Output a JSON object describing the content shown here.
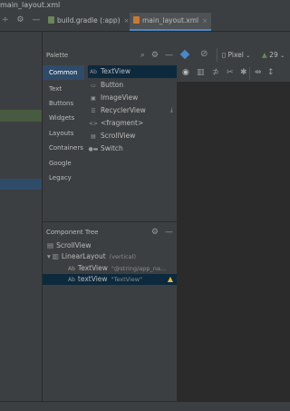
{
  "title": "main_layout.xml",
  "tabs": [
    {
      "label": "build.gradle (:app)",
      "close": "×"
    },
    {
      "label": "main_layout.xml",
      "close": "×"
    }
  ],
  "toolbar_icons": [
    "gear-icon",
    "minus-icon"
  ],
  "palette": {
    "title": "Palette",
    "categories": [
      "Common",
      "Text",
      "Buttons",
      "Widgets",
      "Layouts",
      "Containers",
      "Google",
      "Legacy"
    ],
    "widgets": [
      {
        "icon": "Ab",
        "label": "TextView"
      },
      {
        "icon": "▭",
        "label": "Button"
      },
      {
        "icon": "▣",
        "label": "ImageView"
      },
      {
        "icon": "☰",
        "label": "RecyclerView"
      },
      {
        "icon": "<>",
        "label": "<fragment>"
      },
      {
        "icon": "▤",
        "label": "ScrollView"
      },
      {
        "icon": "●▬",
        "label": "Switch"
      }
    ]
  },
  "design": {
    "device": "Pixel",
    "api": "29"
  },
  "component_tree": {
    "title": "Component Tree",
    "rows": [
      {
        "icon": "▤",
        "label": "ScrollView",
        "extra": ""
      },
      {
        "icon": "▥",
        "label": "LinearLayout",
        "extra": "(vertical)"
      },
      {
        "icon": "Ab",
        "label": "TextView",
        "extra": "\"@string/app_na..."
      },
      {
        "icon": "Ab",
        "label": "textView",
        "extra": "\"TextView\""
      }
    ]
  },
  "colors": {
    "background": "#3c3f41",
    "canvas": "#2b2b2b",
    "selection": "#0d293e",
    "selection_category": "#2f4b6a",
    "accent_blue": "#4a88c7",
    "warning": "#e2b73d"
  }
}
